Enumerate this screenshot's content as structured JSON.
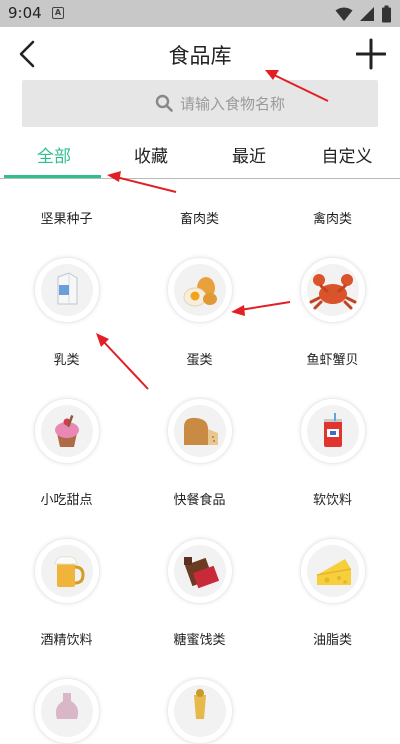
{
  "status": {
    "time": "9:04"
  },
  "header": {
    "title": "食品库"
  },
  "search": {
    "placeholder": "请输入食物名称"
  },
  "tabs": [
    {
      "label": "全部"
    },
    {
      "label": "收藏"
    },
    {
      "label": "最近"
    },
    {
      "label": "自定义"
    }
  ],
  "top_row": [
    {
      "label": "坚果种子"
    },
    {
      "label": "畜肉类"
    },
    {
      "label": "禽肉类"
    }
  ],
  "categories": [
    {
      "label": "乳类",
      "icon": "milk-icon"
    },
    {
      "label": "蛋类",
      "icon": "eggs-icon"
    },
    {
      "label": "鱼虾蟹贝",
      "icon": "crab-icon"
    },
    {
      "label": "小吃甜点",
      "icon": "cupcake-icon"
    },
    {
      "label": "快餐食品",
      "icon": "bread-icon"
    },
    {
      "label": "软饮料",
      "icon": "soda-can-icon"
    },
    {
      "label": "酒精饮料",
      "icon": "beer-icon"
    },
    {
      "label": "糖蜜饯类",
      "icon": "chocolate-icon"
    },
    {
      "label": "油脂类",
      "icon": "cheese-icon"
    }
  ],
  "colors": {
    "accent": "#2fbf8f",
    "annotation": "#e11f25"
  }
}
